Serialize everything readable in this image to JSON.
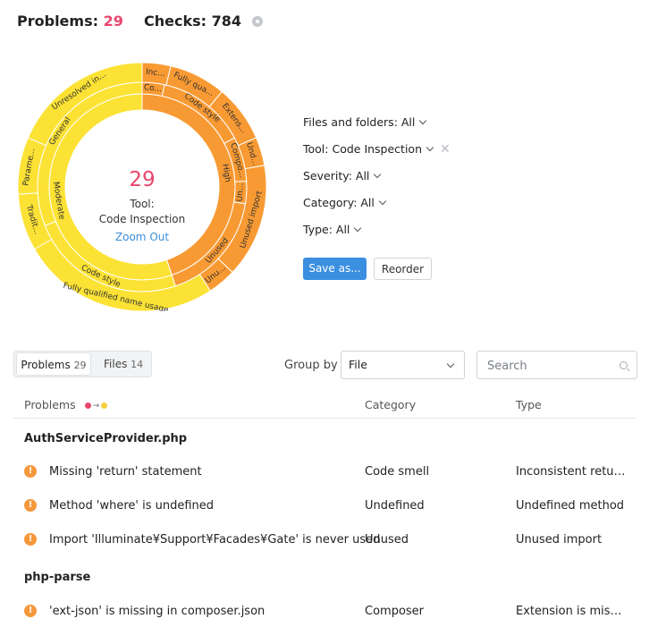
{
  "header": {
    "problems_label": "Problems:",
    "problems_count": "29",
    "checks_label": "Checks:",
    "checks_count": "784",
    "settings_icon": "gear-icon"
  },
  "sunburst": {
    "center_count": "29",
    "center_line1": "Tool:",
    "center_line2": "Code Inspection",
    "zoom_out": "Zoom Out",
    "colors": {
      "high": "#f89a33",
      "moderate": "#fce234",
      "stroke": "#ffffff"
    },
    "inner_ring": [
      {
        "label": "High",
        "severity": "high",
        "value": 13
      },
      {
        "label": "Moderate",
        "severity": "moderate",
        "value": 16
      }
    ],
    "middle_ring": [
      {
        "label": "Co...",
        "severity": "high",
        "value": 1
      },
      {
        "label": "Code style",
        "severity": "high",
        "value": 4
      },
      {
        "label": "Compo...",
        "severity": "high",
        "value": 2
      },
      {
        "label": "Un...",
        "severity": "high",
        "value": 1
      },
      {
        "label": "Unused",
        "severity": "high",
        "value": 5
      },
      {
        "label": "Code style",
        "severity": "moderate",
        "value": 7
      },
      {
        "label": "General",
        "severity": "moderate",
        "value": 9
      }
    ],
    "outer_ring": [
      {
        "label": "Inc...",
        "severity": "high",
        "value": 1
      },
      {
        "label": "Fully qua...",
        "severity": "high",
        "value": 2
      },
      {
        "label": "Extens...",
        "severity": "high",
        "value": 2
      },
      {
        "label": "Und...",
        "severity": "high",
        "value": 1
      },
      {
        "label": "Unused import",
        "severity": "high",
        "value": 4
      },
      {
        "label": "Unu...",
        "severity": "high",
        "value": 1
      },
      {
        "label": "Fully qualified name usage",
        "severity": "moderate",
        "value": 7
      },
      {
        "label": "Tradit...",
        "severity": "moderate",
        "value": 2
      },
      {
        "label": "Parame...",
        "severity": "moderate",
        "value": 2
      },
      {
        "label": "Unresolved in...",
        "severity": "moderate",
        "value": 5
      }
    ]
  },
  "filters": {
    "files": "Files and folders: All",
    "tool": "Tool: Code Inspection",
    "severity": "Severity: All",
    "category": "Category: All",
    "type": "Type: All"
  },
  "actions": {
    "save": "Save as...",
    "reorder": "Reorder"
  },
  "tabs": {
    "problems": {
      "label": "Problems",
      "count": "29"
    },
    "files": {
      "label": "Files",
      "count": "14"
    }
  },
  "group_by": {
    "label": "Group by",
    "value": "File"
  },
  "search": {
    "placeholder": "Search"
  },
  "table": {
    "columns": {
      "problems": "Problems",
      "category": "Category",
      "type": "Type"
    },
    "legend_colors": {
      "from": "#e8466e",
      "to": "#f5cf3f"
    },
    "groups": [
      {
        "title": "AuthServiceProvider.php",
        "rows": [
          {
            "problem": "Missing 'return' statement",
            "category": "Code smell",
            "type": "Inconsistent return points"
          },
          {
            "problem": "Method 'where' is undefined",
            "category": "Undefined",
            "type": "Undefined method"
          },
          {
            "problem": "Import 'Illuminate¥Support¥Facades¥Gate' is never used",
            "category": "Unused",
            "type": "Unused import"
          }
        ]
      },
      {
        "title": "php-parse",
        "rows": [
          {
            "problem": "'ext-json' is missing in composer.json",
            "category": "Composer",
            "type": "Extension is missing in composer.json"
          }
        ]
      }
    ],
    "row_icon": "exclamation-icon",
    "row_icon_glyph": "!"
  }
}
